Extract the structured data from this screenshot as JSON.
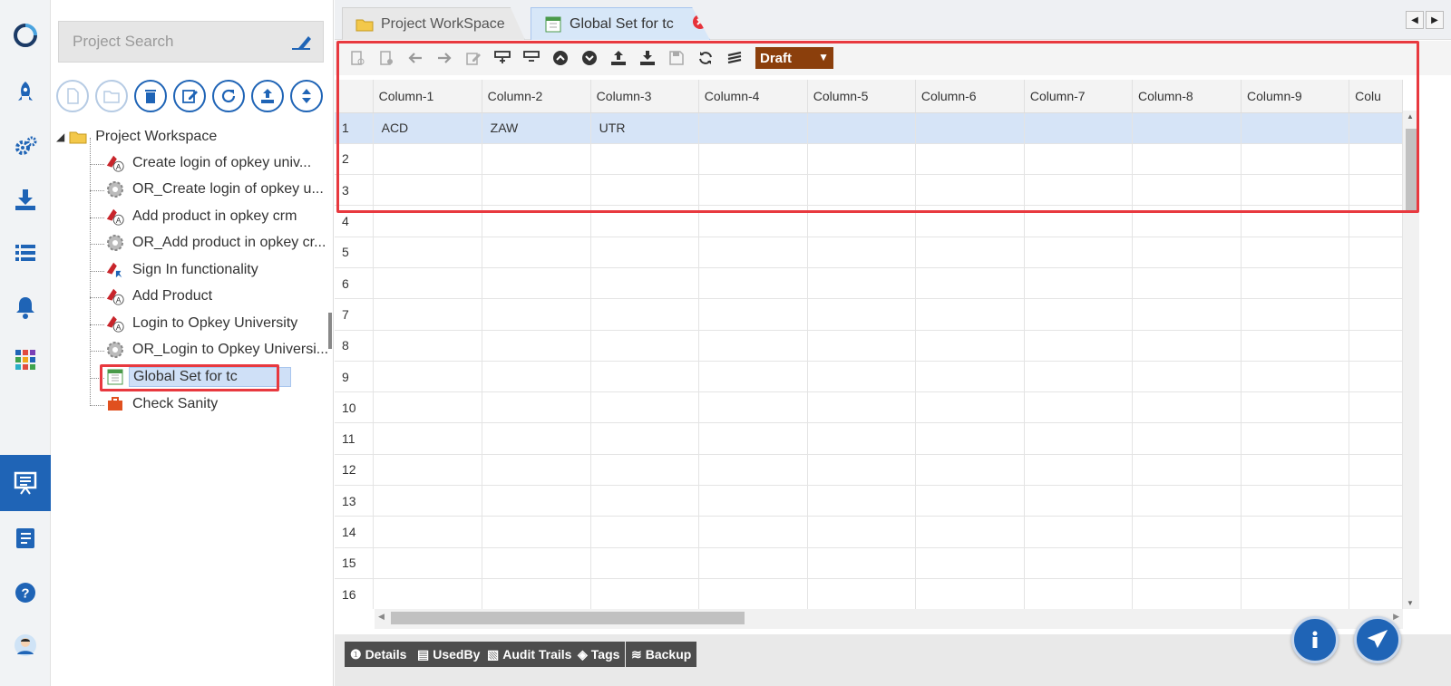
{
  "search": {
    "placeholder": "Project Search"
  },
  "tree": {
    "root": "Project Workspace",
    "items": [
      {
        "label": "Create login of opkey univ...",
        "icon": "keyword-flow-icon"
      },
      {
        "label": "OR_Create login of opkey u...",
        "icon": "object-repository-icon"
      },
      {
        "label": "Add product in opkey crm",
        "icon": "keyword-flow-icon"
      },
      {
        "label": "OR_Add product in opkey cr...",
        "icon": "object-repository-icon"
      },
      {
        "label": "Sign In functionality",
        "icon": "function-library-icon"
      },
      {
        "label": "Add Product",
        "icon": "keyword-flow-icon"
      },
      {
        "label": "Login to Opkey University",
        "icon": "keyword-flow-icon"
      },
      {
        "label": "OR_Login to Opkey Universi...",
        "icon": "object-repository-icon"
      },
      {
        "label": "Global Set for tc",
        "icon": "global-dataset-icon"
      },
      {
        "label": "Check Sanity",
        "icon": "suite-briefcase-icon"
      }
    ]
  },
  "tabs": [
    {
      "label": "Project WorkSpace"
    },
    {
      "label": "Global Set for tc"
    }
  ],
  "status": {
    "value": "Draft",
    "color": "#8b3f0c"
  },
  "grid": {
    "columns": [
      "Column-1",
      "Column-2",
      "Column-3",
      "Column-4",
      "Column-5",
      "Column-6",
      "Column-7",
      "Column-8",
      "Column-9",
      "Colu"
    ],
    "rows": [
      {
        "n": "1",
        "cells": [
          "ACD",
          "ZAW",
          "UTR",
          "",
          "",
          "",
          "",
          "",
          "",
          ""
        ]
      },
      {
        "n": "2",
        "cells": [
          "",
          "",
          "",
          "",
          "",
          "",
          "",
          "",
          "",
          ""
        ]
      },
      {
        "n": "3",
        "cells": [
          "",
          "",
          "",
          "",
          "",
          "",
          "",
          "",
          "",
          ""
        ]
      },
      {
        "n": "4",
        "cells": [
          "",
          "",
          "",
          "",
          "",
          "",
          "",
          "",
          "",
          ""
        ]
      },
      {
        "n": "5",
        "cells": [
          "",
          "",
          "",
          "",
          "",
          "",
          "",
          "",
          "",
          ""
        ]
      },
      {
        "n": "6",
        "cells": [
          "",
          "",
          "",
          "",
          "",
          "",
          "",
          "",
          "",
          ""
        ]
      },
      {
        "n": "7",
        "cells": [
          "",
          "",
          "",
          "",
          "",
          "",
          "",
          "",
          "",
          ""
        ]
      },
      {
        "n": "8",
        "cells": [
          "",
          "",
          "",
          "",
          "",
          "",
          "",
          "",
          "",
          ""
        ]
      },
      {
        "n": "9",
        "cells": [
          "",
          "",
          "",
          "",
          "",
          "",
          "",
          "",
          "",
          ""
        ]
      },
      {
        "n": "10",
        "cells": [
          "",
          "",
          "",
          "",
          "",
          "",
          "",
          "",
          "",
          ""
        ]
      },
      {
        "n": "11",
        "cells": [
          "",
          "",
          "",
          "",
          "",
          "",
          "",
          "",
          "",
          ""
        ]
      },
      {
        "n": "12",
        "cells": [
          "",
          "",
          "",
          "",
          "",
          "",
          "",
          "",
          "",
          ""
        ]
      },
      {
        "n": "13",
        "cells": [
          "",
          "",
          "",
          "",
          "",
          "",
          "",
          "",
          "",
          ""
        ]
      },
      {
        "n": "14",
        "cells": [
          "",
          "",
          "",
          "",
          "",
          "",
          "",
          "",
          "",
          ""
        ]
      },
      {
        "n": "15",
        "cells": [
          "",
          "",
          "",
          "",
          "",
          "",
          "",
          "",
          "",
          ""
        ]
      },
      {
        "n": "16",
        "cells": [
          "",
          "",
          "",
          "",
          "",
          "",
          "",
          "",
          "",
          ""
        ]
      }
    ]
  },
  "bottom_tabs": [
    {
      "label": "Details"
    },
    {
      "label": "UsedBy"
    },
    {
      "label": "Audit Trails"
    },
    {
      "label": "Tags"
    },
    {
      "label": "Backup"
    }
  ],
  "colors": {
    "accent": "#1f64b6",
    "highlight": "#e8393f",
    "selected_row": "#d6e4f7"
  }
}
